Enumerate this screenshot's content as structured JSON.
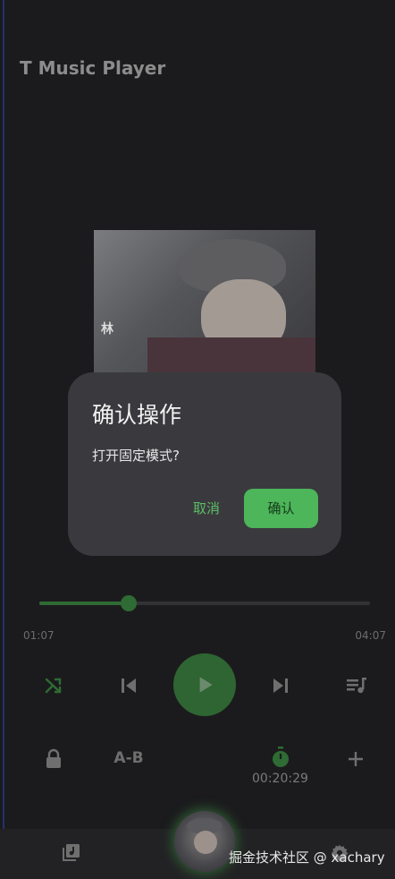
{
  "app": {
    "title": "T Music Player"
  },
  "album": {
    "caption": "林"
  },
  "dialog": {
    "title": "确认操作",
    "message": "打开固定模式?",
    "cancel_label": "取消",
    "confirm_label": "确认"
  },
  "player": {
    "current_time": "01:07",
    "total_time": "04:07",
    "progress": 0.27,
    "ab_label": "A-B",
    "timer": "00:20:29"
  },
  "colors": {
    "accent": "#4db55a",
    "accent_dim": "#2f6b34",
    "background": "#1b1b1d",
    "dialog": "#3a3a3e"
  },
  "icons": [
    "shuffle-icon",
    "skip-previous-icon",
    "play-icon",
    "skip-next-icon",
    "playlist-icon",
    "lock-icon",
    "timer-icon",
    "plus-icon",
    "music-library-icon",
    "settings-icon"
  ],
  "watermark": "掘金技术社区 @ xachary"
}
